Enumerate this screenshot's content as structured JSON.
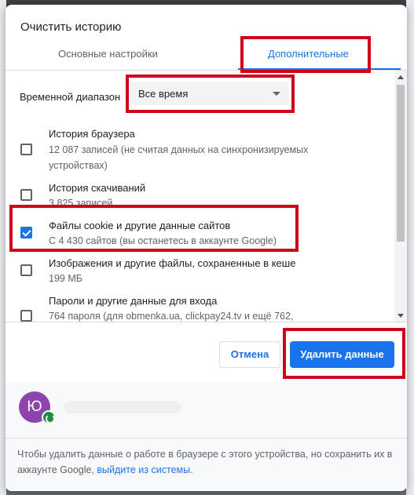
{
  "dialog": {
    "title": "Очистить историю",
    "tabs": [
      {
        "label": "Основные настройки",
        "active": false
      },
      {
        "label": "Дополнительные",
        "active": true
      }
    ]
  },
  "time_range": {
    "label": "Временной диапазон",
    "selected": "Все время"
  },
  "items": [
    {
      "title": "История браузера",
      "subtitle": "12 087 записей (не считая данных на синхронизируемых устройствах)",
      "checked": false
    },
    {
      "title": "История скачиваний",
      "subtitle": "3 825 записей",
      "checked": false
    },
    {
      "title": "Файлы cookie и другие данные сайтов",
      "subtitle": "С 4 430 сайтов (вы останетесь в аккаунте Google)",
      "checked": true
    },
    {
      "title": "Изображения и другие файлы, сохраненные в кеше",
      "subtitle": "199 МБ",
      "checked": false
    },
    {
      "title": "Пароли и другие данные для входа",
      "subtitle": "764 пароля (для obmenka.ua, clickpay24.tv и ещё 762,",
      "checked": false
    }
  ],
  "buttons": {
    "cancel": "Отмена",
    "delete": "Удалить данные"
  },
  "footer": {
    "avatar_letter": "Ю",
    "text": "Чтобы удалить данные о работе в браузере с этого устройства, но сохранить их в аккаунте Google, ",
    "link": "выйдите из системы",
    "text_end": "."
  },
  "colors": {
    "accent": "#1a73e8",
    "highlight": "#d0021b",
    "avatar": "#8e44ad",
    "sync": "#1e8e3e"
  }
}
